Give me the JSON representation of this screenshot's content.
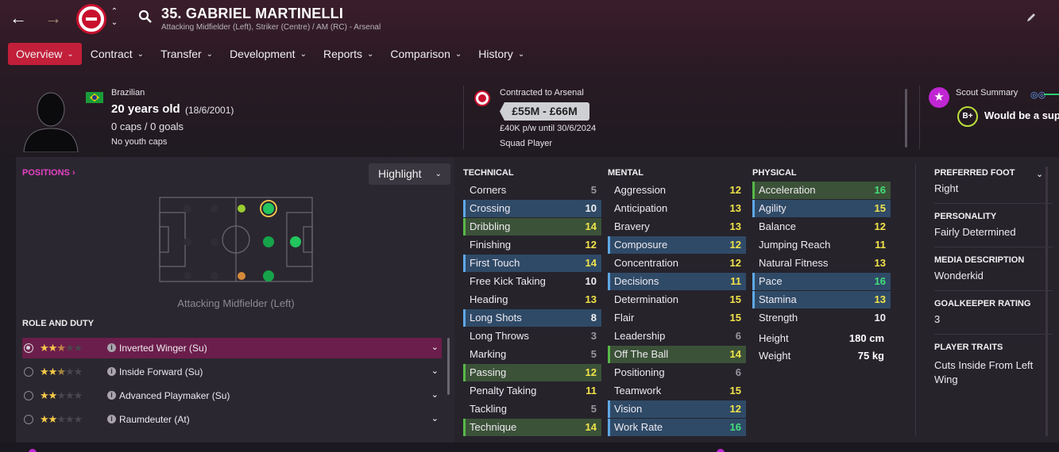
{
  "header": {
    "title": "35. GABRIEL MARTINELLI",
    "subtitle": "Attacking Midfielder (Left), Striker (Centre) / AM (RC) - Arsenal"
  },
  "tabs": [
    {
      "label": "Overview",
      "active": true
    },
    {
      "label": "Contract"
    },
    {
      "label": "Transfer"
    },
    {
      "label": "Development"
    },
    {
      "label": "Reports"
    },
    {
      "label": "Comparison"
    },
    {
      "label": "History"
    }
  ],
  "player": {
    "nationality": "Brazilian",
    "age": "20 years old",
    "dob": "(18/6/2001)",
    "caps": "0 caps / 0 goals",
    "youth_caps": "No youth caps"
  },
  "contract": {
    "status": "Contracted to Arsenal",
    "value": "£55M - £66M",
    "wage": "£40K p/w until 30/6/2024",
    "squad_status": "Squad Player"
  },
  "scout": {
    "label": "Scout Summary",
    "grade": "B+",
    "text": "Would be a supe"
  },
  "positions": {
    "heading": "POSITIONS",
    "highlight_label": "Highlight",
    "caption": "Attacking Midfielder (Left)"
  },
  "role_duty": {
    "heading": "ROLE AND DUTY",
    "roles": [
      {
        "name": "Inverted Winger (Su)",
        "stars": 2.5,
        "selected": true
      },
      {
        "name": "Inside Forward (Su)",
        "stars": 2.5,
        "selected": false
      },
      {
        "name": "Advanced Playmaker (Su)",
        "stars": 2,
        "selected": false
      },
      {
        "name": "Raumdeuter (At)",
        "stars": 2,
        "selected": false
      }
    ]
  },
  "technical": {
    "heading": "TECHNICAL",
    "attrs": [
      {
        "name": "Corners",
        "value": "5",
        "hl": ""
      },
      {
        "name": "Crossing",
        "value": "10",
        "hl": "blue"
      },
      {
        "name": "Dribbling",
        "value": "14",
        "hl": "green"
      },
      {
        "name": "Finishing",
        "value": "12",
        "hl": ""
      },
      {
        "name": "First Touch",
        "value": "14",
        "hl": "blue"
      },
      {
        "name": "Free Kick Taking",
        "value": "10",
        "hl": ""
      },
      {
        "name": "Heading",
        "value": "13",
        "hl": ""
      },
      {
        "name": "Long Shots",
        "value": "8",
        "hl": "blue"
      },
      {
        "name": "Long Throws",
        "value": "3",
        "hl": ""
      },
      {
        "name": "Marking",
        "value": "5",
        "hl": ""
      },
      {
        "name": "Passing",
        "value": "12",
        "hl": "green"
      },
      {
        "name": "Penalty Taking",
        "value": "11",
        "hl": ""
      },
      {
        "name": "Tackling",
        "value": "5",
        "hl": ""
      },
      {
        "name": "Technique",
        "value": "14",
        "hl": "green"
      }
    ]
  },
  "mental": {
    "heading": "MENTAL",
    "attrs": [
      {
        "name": "Aggression",
        "value": "12",
        "hl": ""
      },
      {
        "name": "Anticipation",
        "value": "13",
        "hl": ""
      },
      {
        "name": "Bravery",
        "value": "13",
        "hl": ""
      },
      {
        "name": "Composure",
        "value": "12",
        "hl": "blue"
      },
      {
        "name": "Concentration",
        "value": "12",
        "hl": ""
      },
      {
        "name": "Decisions",
        "value": "11",
        "hl": "blue"
      },
      {
        "name": "Determination",
        "value": "15",
        "hl": ""
      },
      {
        "name": "Flair",
        "value": "15",
        "hl": ""
      },
      {
        "name": "Leadership",
        "value": "6",
        "hl": ""
      },
      {
        "name": "Off The Ball",
        "value": "14",
        "hl": "green"
      },
      {
        "name": "Positioning",
        "value": "6",
        "hl": ""
      },
      {
        "name": "Teamwork",
        "value": "15",
        "hl": ""
      },
      {
        "name": "Vision",
        "value": "12",
        "hl": "blue"
      },
      {
        "name": "Work Rate",
        "value": "16",
        "hl": "blue"
      }
    ]
  },
  "physical": {
    "heading": "PHYSICAL",
    "attrs": [
      {
        "name": "Acceleration",
        "value": "16",
        "hl": "green"
      },
      {
        "name": "Agility",
        "value": "15",
        "hl": "blue"
      },
      {
        "name": "Balance",
        "value": "12",
        "hl": ""
      },
      {
        "name": "Jumping Reach",
        "value": "11",
        "hl": ""
      },
      {
        "name": "Natural Fitness",
        "value": "13",
        "hl": ""
      },
      {
        "name": "Pace",
        "value": "16",
        "hl": "blue"
      },
      {
        "name": "Stamina",
        "value": "13",
        "hl": "blue"
      },
      {
        "name": "Strength",
        "value": "10",
        "hl": ""
      }
    ],
    "height_label": "Height",
    "height": "180 cm",
    "weight_label": "Weight",
    "weight": "75 kg"
  },
  "sidebar": {
    "preferred_foot_label": "PREFERRED FOOT",
    "preferred_foot": "Right",
    "personality_label": "PERSONALITY",
    "personality": "Fairly Determined",
    "media_label": "MEDIA DESCRIPTION",
    "media": "Wonderkid",
    "gk_label": "GOALKEEPER RATING",
    "gk": "3",
    "traits_label": "PLAYER TRAITS",
    "traits": "Cuts Inside From Left Wing"
  },
  "colors": {
    "accent": "#c21f3a",
    "positions_heading": "#e542c7",
    "selected_role": "#6b1e4b"
  }
}
